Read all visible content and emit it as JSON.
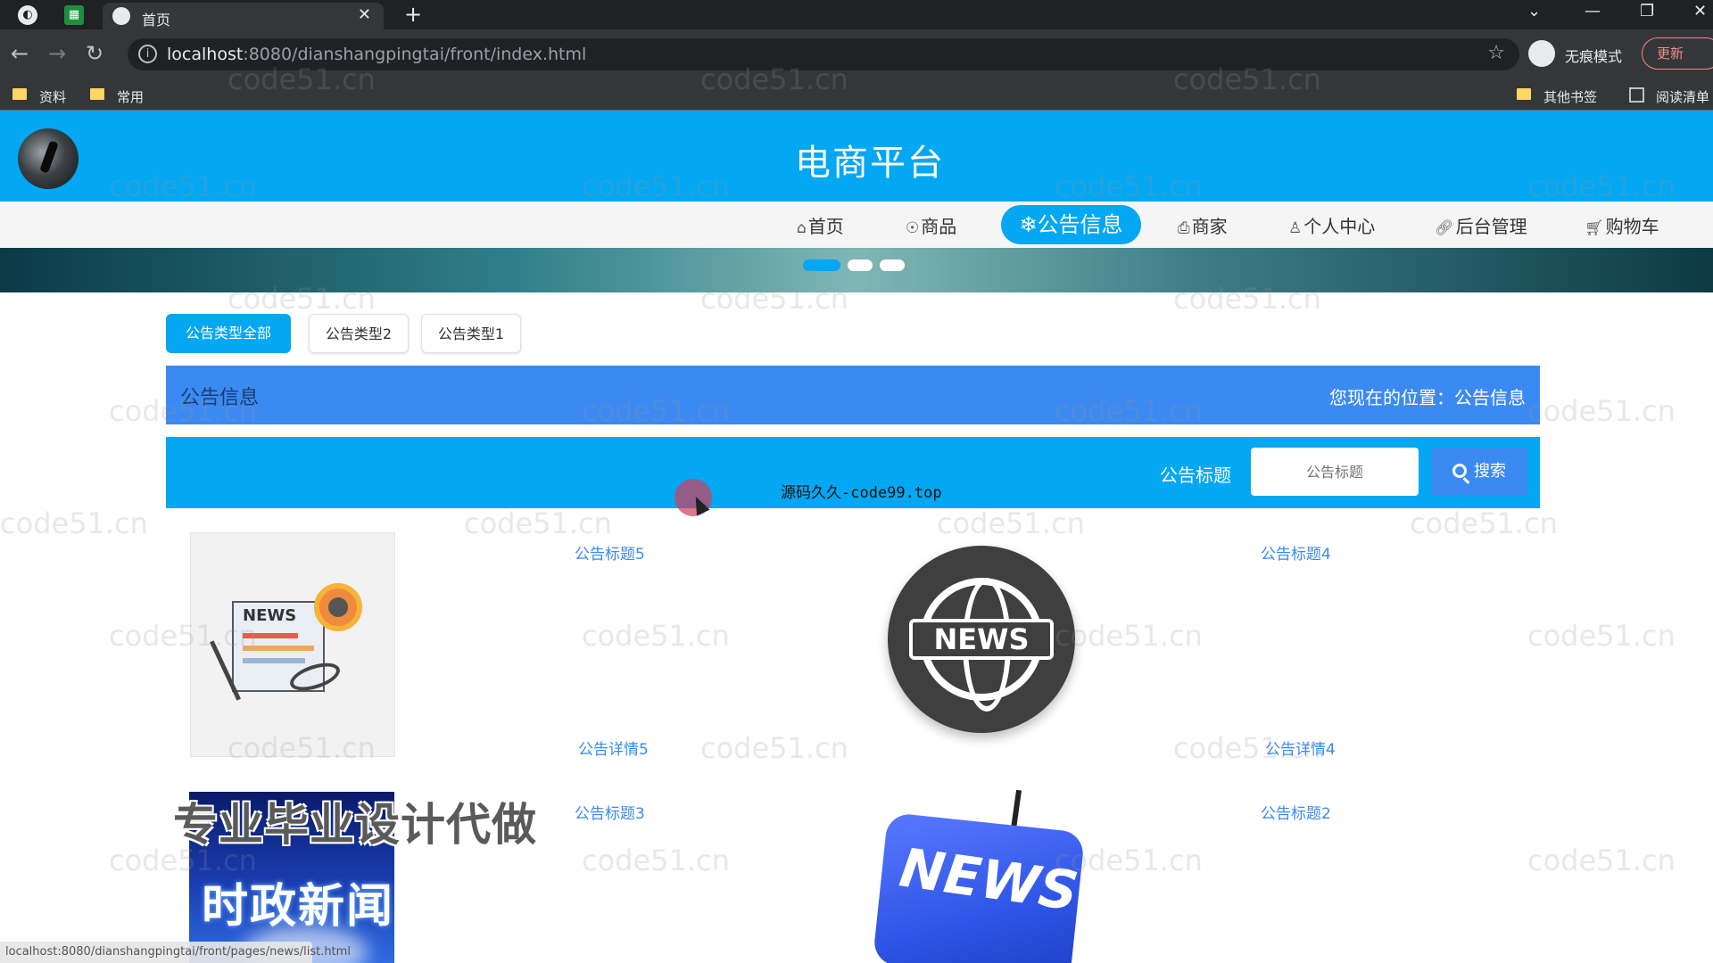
{
  "browser": {
    "tab_title": "首页",
    "tab_close": "✕",
    "new_tab": "+",
    "url_host": "localhost",
    "url_rest": ":8080/dianshangpingtai/front/index.html",
    "incognito_label": "无痕模式",
    "update_label": "更新",
    "bookmarks": [
      "资料",
      "常用"
    ],
    "other_bookmarks": "其他书签",
    "reading_list": "阅读清单"
  },
  "header": {
    "site_title": "电商平台"
  },
  "nav": {
    "items": [
      {
        "label": "首页",
        "icon": "home-icon"
      },
      {
        "label": "商品",
        "icon": "product-icon"
      },
      {
        "label": "公告信息",
        "icon": "snowflake-icon"
      },
      {
        "label": "商家",
        "icon": "printer-icon"
      },
      {
        "label": "个人中心",
        "icon": "user-icon"
      },
      {
        "label": "后台管理",
        "icon": "link-icon"
      },
      {
        "label": "购物车",
        "icon": "cart-icon"
      }
    ],
    "active_index": 2
  },
  "carousel": {
    "slide_count": 3,
    "active_slide": 0
  },
  "filters": [
    "公告类型全部",
    "公告类型2",
    "公告类型1"
  ],
  "section": {
    "title": "公告信息",
    "location": "您现在的位置：公告信息"
  },
  "search": {
    "label": "公告标题",
    "placeholder": "公告标题",
    "button_label": "搜索"
  },
  "overlay_text": "源码久久-code99.top",
  "announcements": [
    {
      "title": "公告标题5",
      "detail": "公告详情5",
      "image": "news-paper-illustration"
    },
    {
      "title": "公告标题4",
      "detail": "公告详情4",
      "image": "news-globe-icon"
    },
    {
      "title": "公告标题3",
      "detail": "",
      "image": "politics-news-graphic"
    },
    {
      "title": "公告标题2",
      "detail": "",
      "image": "news-key-photo"
    }
  ],
  "images": {
    "news_word": "NEWS",
    "politics_text": "时政新闻"
  },
  "promo_text": "专业毕业设计代做",
  "watermark": "code51.cn",
  "status_url": "localhost:8080/dianshangpingtai/front/pages/news/list.html",
  "colors": {
    "primary": "#04a7f2",
    "secondary": "#3b8af2",
    "link": "#3b8af2"
  }
}
